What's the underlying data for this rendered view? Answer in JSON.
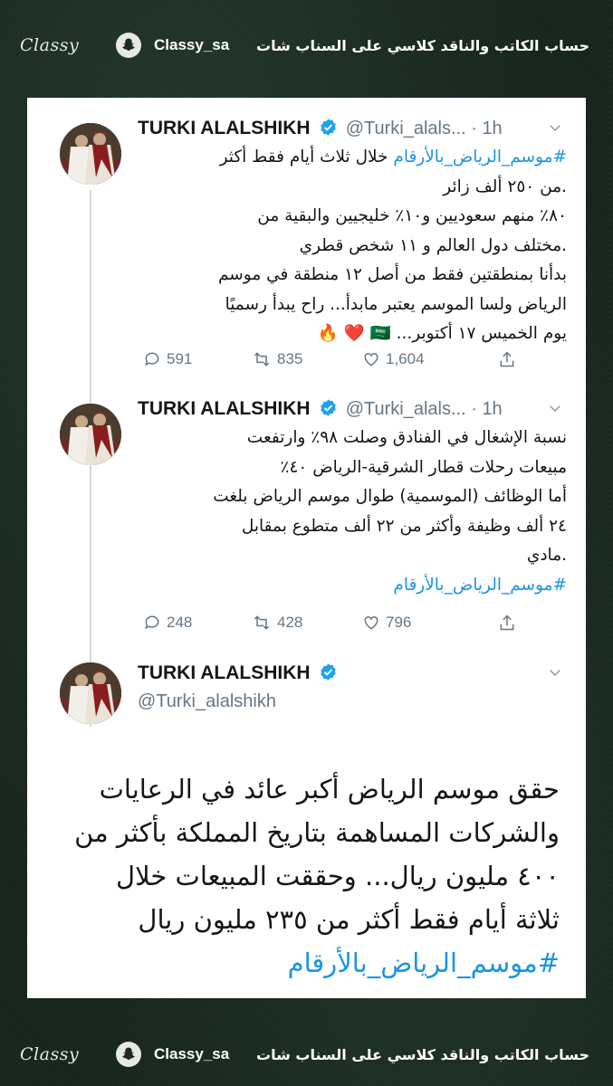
{
  "overlay": {
    "logo": "Classy",
    "handle": "Classy_sa",
    "caption": "حساب الكاتب والناقد كلاسي على السناب شات"
  },
  "tweets": [
    {
      "name": "TURKI ALALSHIKH",
      "handle_time": "@Turki_alals... · 1h",
      "lines": [
        "#موسم_الرياض_بالأرقام خلال ثلاث أيام فقط أكثر",
        ".من ٢٥٠ ألف زائر",
        "٨٠٪ منهم سعوديين و١٠٪ خليجيين والبقية من",
        ".مختلف دول العالم و ١١ شخص قطري",
        "بدأنا بمنطقتين فقط من أصل ١٢ منطقة في موسم",
        "الرياض ولسا الموسم يعتبر مابدأ... راح يبدأ رسميًا",
        "يوم الخميس ١٧ أكتوبر... 🇸🇦 ❤️ 🔥"
      ],
      "hashtag": "#موسم_الرياض_بالأرقام",
      "replies": "591",
      "retweets": "835",
      "likes": "1,604"
    },
    {
      "name": "TURKI ALALSHIKH",
      "handle_time": "@Turki_alals... · 1h",
      "lines": [
        "نسبة الإشغال في الفنادق وصلت ٩٨٪ وارتفعت",
        "مبيعات رحلات قطار الشرقية-الرياض ٤٠٪",
        "أما الوظائف (الموسمية) طوال موسم الرياض بلغت",
        "٢٤ ألف وظيفة وأكثر من ٢٢ ألف متطوع بمقابل",
        ".مادي",
        "#موسم_الرياض_بالأرقام"
      ],
      "replies": "248",
      "retweets": "428",
      "likes": "796"
    },
    {
      "name": "TURKI ALALSHIKH",
      "handle": "@Turki_alalshikh",
      "lines": [
        "حقق موسم الرياض أكبر عائد في الرعايات",
        "والشركات المساهمة بتاريخ المملكة بأكثر من",
        "٤٠٠ مليون ريال... وحققت المبيعات خلال",
        "ثلاثة أيام فقط أكثر من ٢٣٥ مليون ريال",
        "#موسم_الرياض_بالأرقام"
      ]
    }
  ],
  "colors": {
    "link": "#1b95e0",
    "verified": "#1da1f2",
    "muted": "#657786"
  }
}
